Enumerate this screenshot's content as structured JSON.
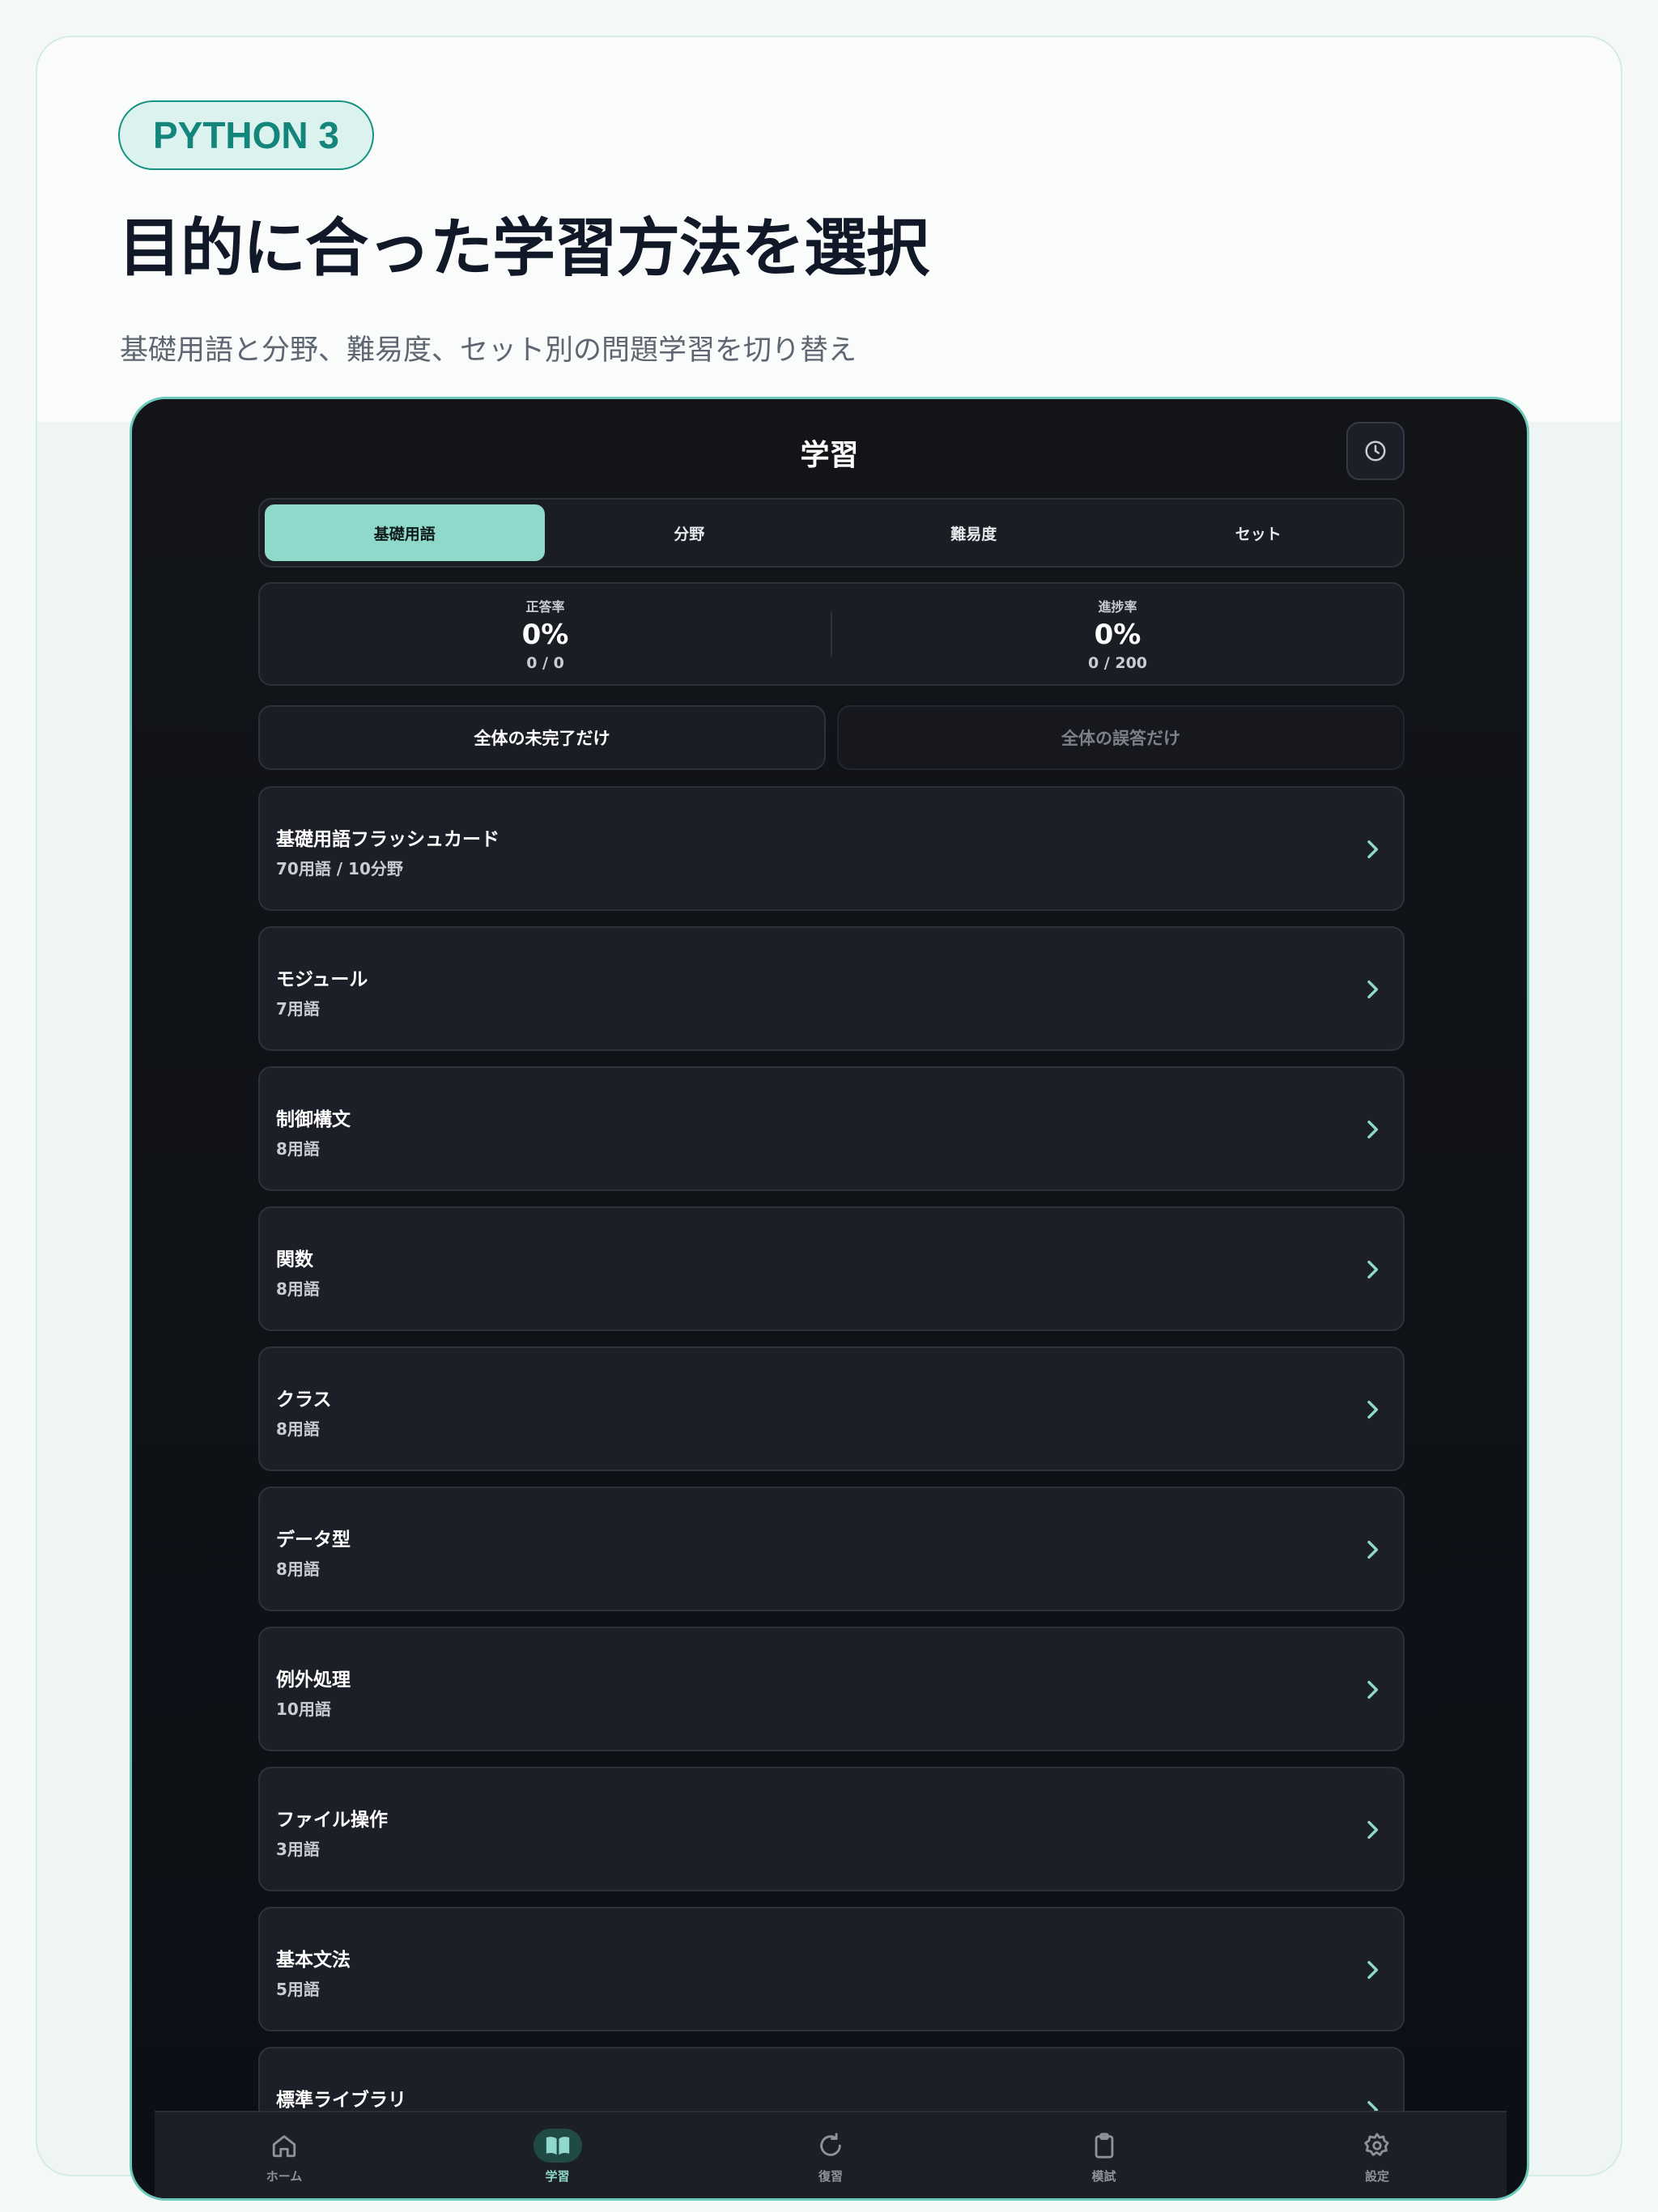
{
  "badge": "PYTHON 3",
  "headline": "目的に合った学習方法を選択",
  "subhead": "基礎用語と分野、難易度、セット別の問題学習を切り替え",
  "app": {
    "title": "学習",
    "history_icon": "clock-icon",
    "segments": [
      {
        "label": "基礎用語",
        "active": true
      },
      {
        "label": "分野",
        "active": false
      },
      {
        "label": "難易度",
        "active": false
      },
      {
        "label": "セット",
        "active": false
      }
    ],
    "stats": {
      "accuracy": {
        "label": "正答率",
        "value": "0%",
        "sub": "0 / 0"
      },
      "progress": {
        "label": "進捗率",
        "value": "0%",
        "sub": "0 / 200"
      }
    },
    "filters": {
      "incomplete": "全体の未完了だけ",
      "wrong": "全体の誤答だけ"
    },
    "items": [
      {
        "title": "基礎用語フラッシュカード",
        "sub": "70用語 / 10分野"
      },
      {
        "title": "モジュール",
        "sub": "7用語"
      },
      {
        "title": "制御構文",
        "sub": "8用語"
      },
      {
        "title": "関数",
        "sub": "8用語"
      },
      {
        "title": "クラス",
        "sub": "8用語"
      },
      {
        "title": "データ型",
        "sub": "8用語"
      },
      {
        "title": "例外処理",
        "sub": "10用語"
      },
      {
        "title": "ファイル操作",
        "sub": "3用語"
      },
      {
        "title": "基本文法",
        "sub": "5用語"
      },
      {
        "title": "標準ライブラリ",
        "sub": ""
      }
    ],
    "tabs": [
      {
        "label": "ホーム",
        "icon": "home-icon"
      },
      {
        "label": "学習",
        "icon": "book-icon",
        "active": true
      },
      {
        "label": "復習",
        "icon": "refresh-icon"
      },
      {
        "label": "模試",
        "icon": "clipboard-icon"
      },
      {
        "label": "設定",
        "icon": "gear-icon"
      }
    ],
    "colors": {
      "accent": "#8ed8cc",
      "background": "#101318",
      "card": "#1c1f27"
    }
  }
}
